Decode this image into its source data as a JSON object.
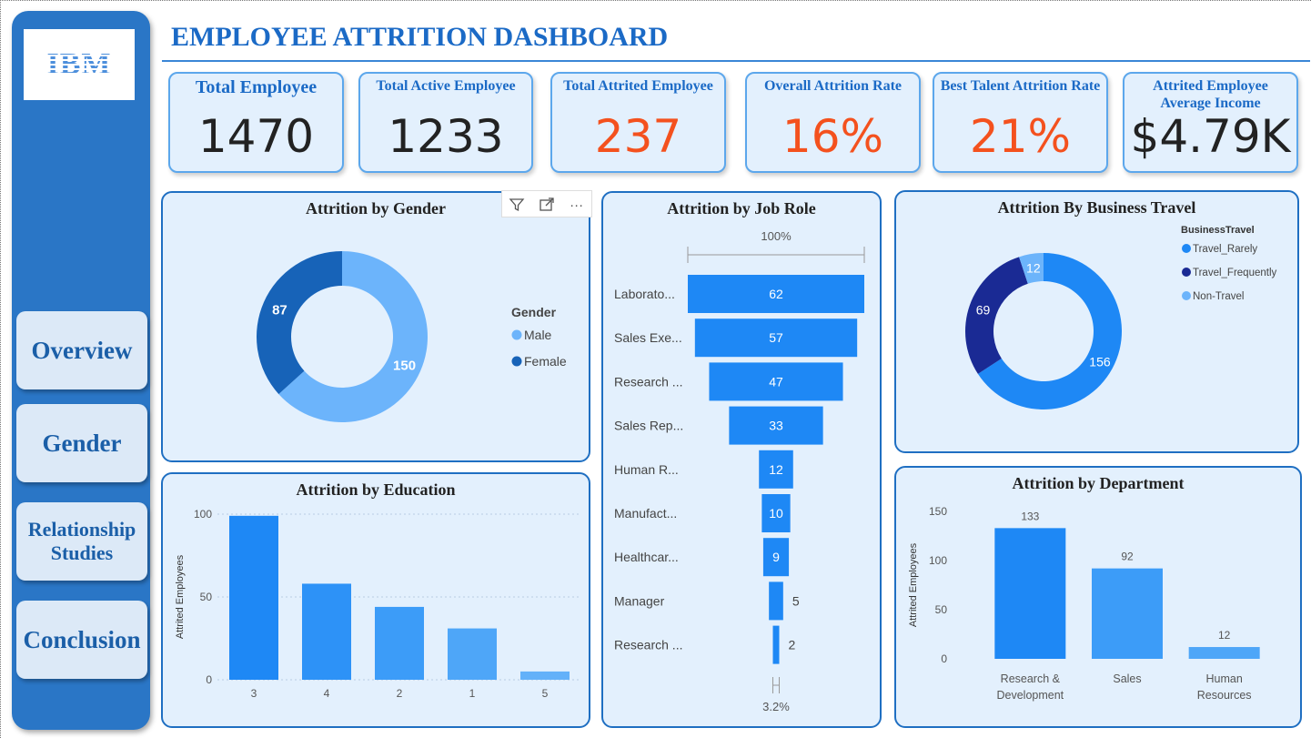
{
  "dashboard": {
    "title": "EMPLOYEE ATTRITION DASHBOARD"
  },
  "sidebar": {
    "logo_text": "IBM",
    "nav": [
      {
        "label": "Overview"
      },
      {
        "label": "Gender"
      },
      {
        "label": "Relationship Studies"
      },
      {
        "label": "Conclusion"
      }
    ]
  },
  "kpis": [
    {
      "label": "Total Employee",
      "value": "1470",
      "color": "#222222"
    },
    {
      "label": "Total Active Employee",
      "value": "1233",
      "color": "#222222"
    },
    {
      "label": "Total Attrited Employee",
      "value": "237",
      "color": "#f4511e"
    },
    {
      "label": "Overall Attrition Rate",
      "value": "16%",
      "color": "#f4511e"
    },
    {
      "label": "Best Talent Attrition Rate",
      "value": "21%",
      "color": "#f4511e"
    },
    {
      "label": "Attrited Employee Average Income",
      "value": "$4.79K",
      "color": "#222222"
    }
  ],
  "toolbar": {
    "icons": [
      "filter-icon",
      "focus-mode-icon",
      "more-options-icon"
    ],
    "more_label": "···"
  },
  "gender_chart": {
    "title": "Attrition by Gender",
    "legend_title": "Gender",
    "legend": [
      {
        "name": "Male",
        "color": "#6cb4fb"
      },
      {
        "name": "Female",
        "color": "#1763b8"
      }
    ]
  },
  "job_role_chart": {
    "title": "Attrition by Job Role",
    "top_pct": "100%",
    "bottom_pct": "3.2%"
  },
  "travel_chart": {
    "title": "Attrition By Business Travel",
    "legend_title": "BusinessTravel",
    "legend": [
      {
        "name": "Travel_Rarely",
        "color": "#1e88f5"
      },
      {
        "name": "Travel_Frequently",
        "color": "#1a2a94"
      },
      {
        "name": "Non-Travel",
        "color": "#6cb4fb"
      }
    ]
  },
  "education_chart": {
    "title": "Attrition by Education",
    "ylabel": "Attrited Employees"
  },
  "department_chart": {
    "title": "Attrition by Department",
    "ylabel": "Attrited Employees"
  },
  "chart_data": [
    {
      "type": "pie",
      "title": "Attrition by Gender",
      "labels": [
        "Male",
        "Female"
      ],
      "values": [
        150,
        87
      ]
    },
    {
      "type": "bar",
      "title": "Attrition by Job Role",
      "subtype": "funnel",
      "categories": [
        "Laborato...",
        "Sales Exe...",
        "Research ...",
        "Sales Rep...",
        "Human R...",
        "Manufact...",
        "Healthcar...",
        "Manager",
        "Research ..."
      ],
      "values": [
        62,
        57,
        47,
        33,
        12,
        10,
        9,
        5,
        2
      ]
    },
    {
      "type": "pie",
      "title": "Attrition By Business Travel",
      "labels": [
        "Travel_Rarely",
        "Travel_Frequently",
        "Non-Travel"
      ],
      "values": [
        156,
        69,
        12
      ]
    },
    {
      "type": "bar",
      "title": "Attrition by Education",
      "categories": [
        "3",
        "4",
        "2",
        "1",
        "5"
      ],
      "values": [
        99,
        58,
        44,
        31,
        5
      ],
      "ylabel": "Attrited Employees",
      "ylim": [
        0,
        100
      ],
      "yticks": [
        0,
        50,
        100
      ]
    },
    {
      "type": "bar",
      "title": "Attrition by Department",
      "categories": [
        "Research & Development",
        "Sales",
        "Human Resources"
      ],
      "category_lines": [
        [
          "Research &",
          "Development"
        ],
        [
          "Sales"
        ],
        [
          "Human",
          "Resources"
        ]
      ],
      "values": [
        133,
        92,
        12
      ],
      "ylabel": "Attrited Employees",
      "ylim": [
        0,
        150
      ],
      "yticks": [
        0,
        50,
        100,
        150
      ]
    }
  ]
}
